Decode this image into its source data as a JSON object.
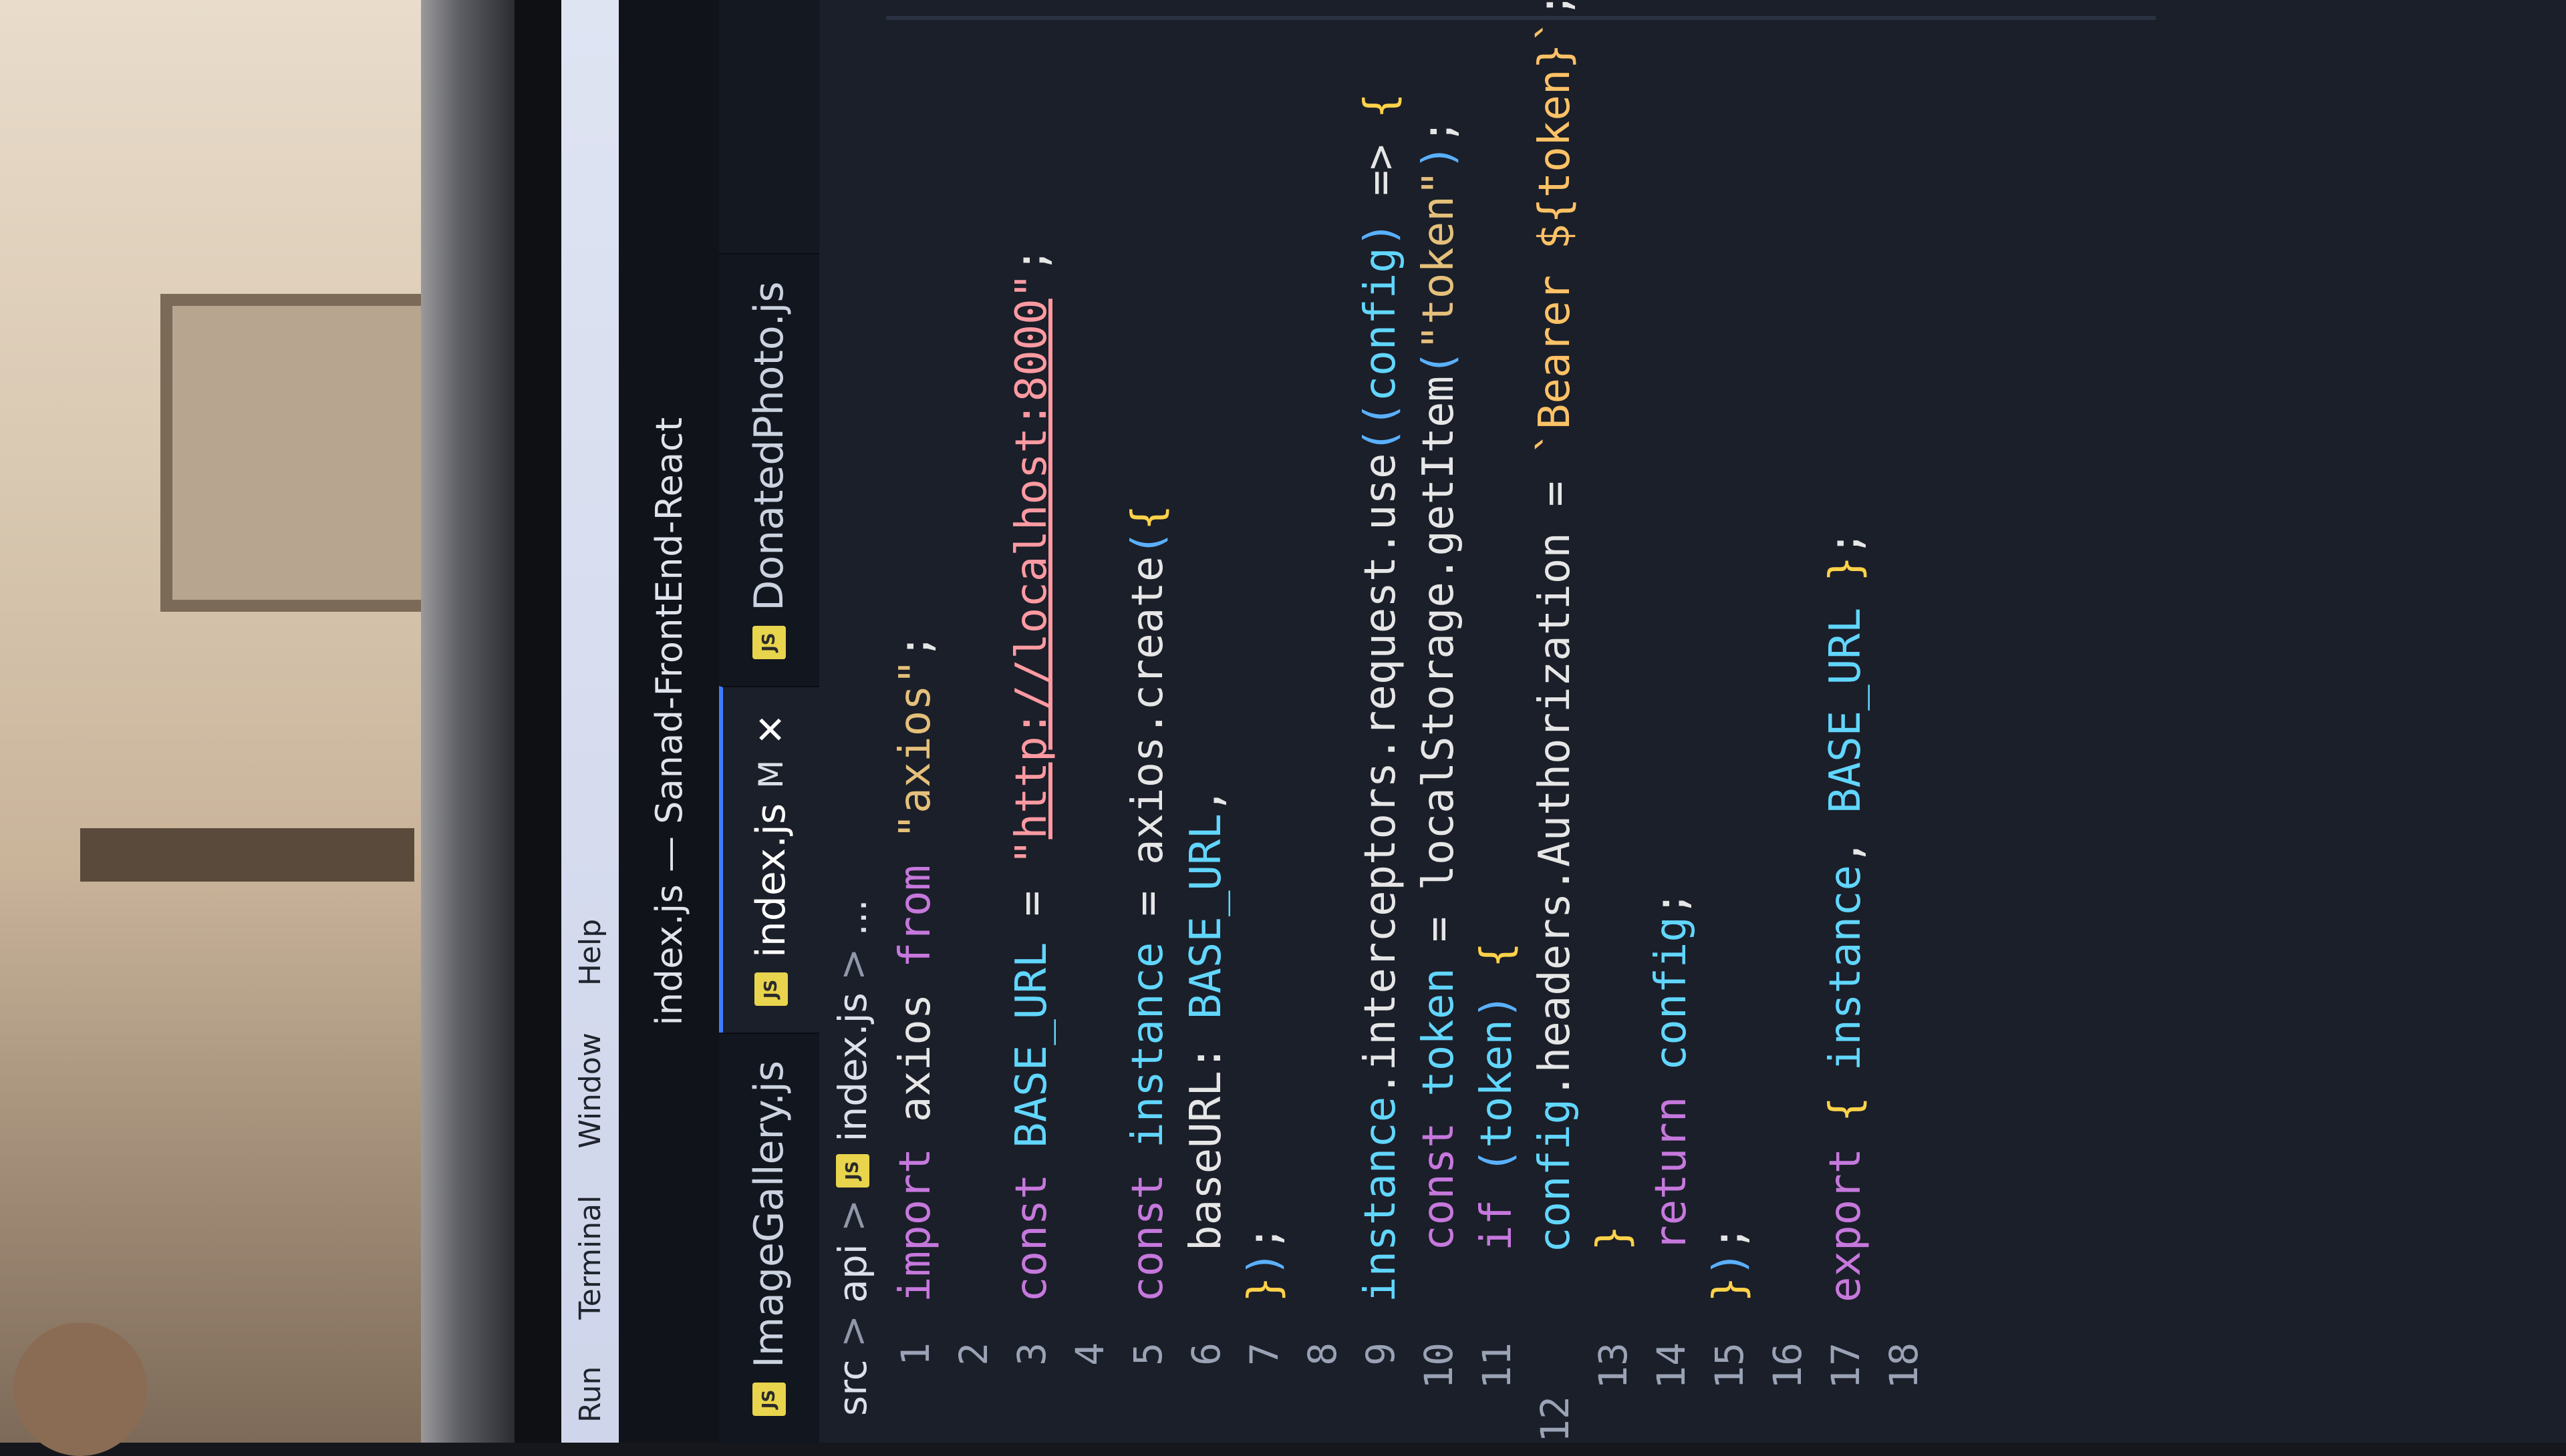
{
  "menu": [
    "Run",
    "Terminal",
    "Window",
    "Help"
  ],
  "window_title": "index.js — Sanad-FrontEnd-React",
  "tabs": [
    {
      "label": "ImageGallery.js",
      "badge": "JS",
      "active": false
    },
    {
      "label": "index.js",
      "badge": "JS",
      "active": true,
      "modified": "M",
      "close": "✕"
    },
    {
      "label": "DonatedPhoto.js",
      "badge": "JS",
      "active": false
    }
  ],
  "breadcrumb": [
    "src",
    "api",
    "index.js",
    "..."
  ],
  "breadcrumb_sep": ">",
  "code_lines": [
    {
      "n": "1",
      "text": "import axios from \"axios\";"
    },
    {
      "n": "2",
      "text": ""
    },
    {
      "n": "3",
      "text": "const BASE_URL = \"http://localhost:8000\";"
    },
    {
      "n": "4",
      "text": ""
    },
    {
      "n": "5",
      "text": "const instance = axios.create({"
    },
    {
      "n": "6",
      "text": "  baseURL: BASE_URL,"
    },
    {
      "n": "7",
      "text": "});"
    },
    {
      "n": "8",
      "text": ""
    },
    {
      "n": "9",
      "text": "instance.interceptors.request.use((config) => {"
    },
    {
      "n": "10",
      "text": "  const token = localStorage.getItem(\"token\");"
    },
    {
      "n": "11",
      "text": "  if (token) {"
    },
    {
      "n": "12",
      "text": "    config.headers.Authorization = `Bearer ${token}`;"
    },
    {
      "n": "13",
      "text": "  }"
    },
    {
      "n": "14",
      "text": "  return config;"
    },
    {
      "n": "15",
      "text": "});"
    },
    {
      "n": "16",
      "text": ""
    },
    {
      "n": "17",
      "text": "export { instance, BASE_URL };"
    },
    {
      "n": "18",
      "text": ""
    }
  ],
  "colors": {
    "accent": "#3d7dff",
    "editor_bg": "#1b1f29",
    "js_badge": "#e8d44d"
  }
}
